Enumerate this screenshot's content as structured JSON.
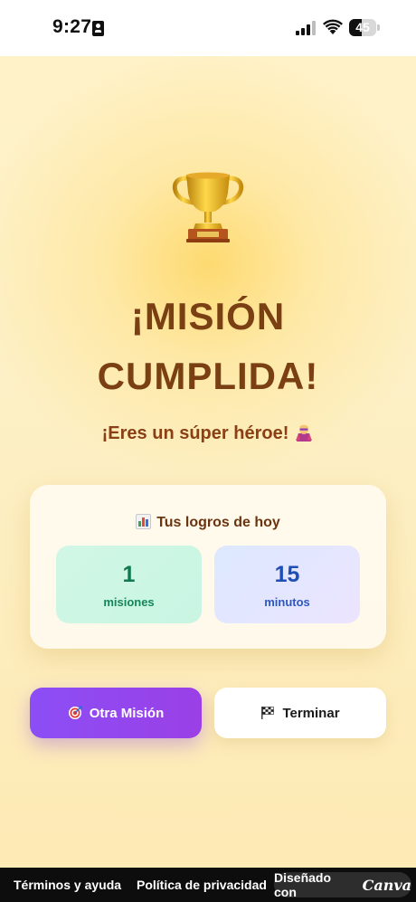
{
  "status_bar": {
    "time": "9:27",
    "battery_level": "45",
    "battery_fraction": 0.45
  },
  "main": {
    "trophy_icon": "trophy-icon",
    "title_line1": "¡MISIÓN",
    "title_line2": "CUMPLIDA!",
    "subtitle": "¡Eres un súper héroe!",
    "subtitle_icon": "superhero-icon"
  },
  "stats": {
    "header": "Tus logros de hoy",
    "header_icon": "bar-chart-icon",
    "missions": {
      "value": "1",
      "label": "misiones"
    },
    "minutes": {
      "value": "15",
      "label": "minutos"
    }
  },
  "buttons": {
    "again_label": "Otra Misión",
    "again_icon": "target-icon",
    "finish_label": "Terminar",
    "finish_icon": "checkered-flag-icon"
  },
  "footer": {
    "terms": "Términos y ayuda",
    "privacy": "Política de privacidad",
    "designed_with": "Diseñado con",
    "canva": "Canva"
  },
  "colors": {
    "title": "#7a3f12",
    "purple_button": "#8b4ff5",
    "missions_green": "#0f7a4e",
    "minutes_blue": "#1f4fb5",
    "footer_bg": "#0d0d0d"
  }
}
